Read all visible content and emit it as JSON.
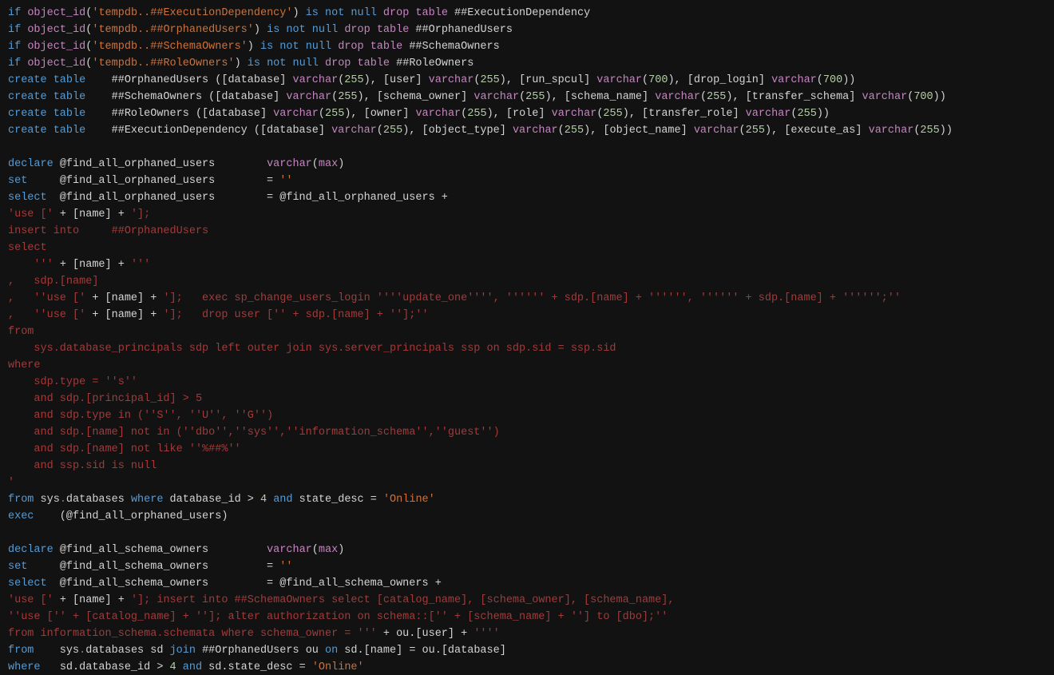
{
  "tokens": [
    [
      [
        "kw",
        "if "
      ],
      [
        "fn",
        "object_id"
      ],
      [
        "op",
        "("
      ],
      [
        "str",
        "'tempdb..##ExecutionDependency'"
      ],
      [
        "op",
        ") "
      ],
      [
        "kw",
        "is not null "
      ],
      [
        "fn",
        "drop table"
      ],
      [
        "id",
        " ##ExecutionDependency"
      ]
    ],
    [
      [
        "kw",
        "if "
      ],
      [
        "fn",
        "object_id"
      ],
      [
        "op",
        "("
      ],
      [
        "str",
        "'tempdb..##OrphanedUsers'"
      ],
      [
        "op",
        ") "
      ],
      [
        "kw",
        "is not null "
      ],
      [
        "fn",
        "drop table"
      ],
      [
        "id",
        " ##OrphanedUsers"
      ]
    ],
    [
      [
        "kw",
        "if "
      ],
      [
        "fn",
        "object_id"
      ],
      [
        "op",
        "("
      ],
      [
        "str",
        "'tempdb..##SchemaOwners'"
      ],
      [
        "op",
        ") "
      ],
      [
        "kw",
        "is not null "
      ],
      [
        "fn",
        "drop table"
      ],
      [
        "id",
        " ##SchemaOwners"
      ]
    ],
    [
      [
        "kw",
        "if "
      ],
      [
        "fn",
        "object_id"
      ],
      [
        "op",
        "("
      ],
      [
        "str",
        "'tempdb..##RoleOwners'"
      ],
      [
        "op",
        ") "
      ],
      [
        "kw",
        "is not null "
      ],
      [
        "fn",
        "drop table"
      ],
      [
        "id",
        " ##RoleOwners"
      ]
    ],
    [
      [
        "kw",
        "create table"
      ],
      [
        "id",
        "    ##OrphanedUsers ([database] "
      ],
      [
        "fn",
        "varchar"
      ],
      [
        "op",
        "("
      ],
      [
        "num",
        "255"
      ],
      [
        "op",
        "), [user] "
      ],
      [
        "fn",
        "varchar"
      ],
      [
        "op",
        "("
      ],
      [
        "num",
        "255"
      ],
      [
        "op",
        "), [run_spcul] "
      ],
      [
        "fn",
        "varchar"
      ],
      [
        "op",
        "("
      ],
      [
        "num",
        "700"
      ],
      [
        "op",
        "), [drop_login] "
      ],
      [
        "fn",
        "varchar"
      ],
      [
        "op",
        "("
      ],
      [
        "num",
        "700"
      ],
      [
        "op",
        "))"
      ]
    ],
    [
      [
        "kw",
        "create table"
      ],
      [
        "id",
        "    ##SchemaOwners ([database] "
      ],
      [
        "fn",
        "varchar"
      ],
      [
        "op",
        "("
      ],
      [
        "num",
        "255"
      ],
      [
        "op",
        "), [schema_owner] "
      ],
      [
        "fn",
        "varchar"
      ],
      [
        "op",
        "("
      ],
      [
        "num",
        "255"
      ],
      [
        "op",
        "), [schema_name] "
      ],
      [
        "fn",
        "varchar"
      ],
      [
        "op",
        "("
      ],
      [
        "num",
        "255"
      ],
      [
        "op",
        "), [transfer_schema] "
      ],
      [
        "fn",
        "varchar"
      ],
      [
        "op",
        "("
      ],
      [
        "num",
        "700"
      ],
      [
        "op",
        "))"
      ]
    ],
    [
      [
        "kw",
        "create table"
      ],
      [
        "id",
        "    ##RoleOwners ([database] "
      ],
      [
        "fn",
        "varchar"
      ],
      [
        "op",
        "("
      ],
      [
        "num",
        "255"
      ],
      [
        "op",
        "), [owner] "
      ],
      [
        "fn",
        "varchar"
      ],
      [
        "op",
        "("
      ],
      [
        "num",
        "255"
      ],
      [
        "op",
        "), [role] "
      ],
      [
        "fn",
        "varchar"
      ],
      [
        "op",
        "("
      ],
      [
        "num",
        "255"
      ],
      [
        "op",
        "), [transfer_role] "
      ],
      [
        "fn",
        "varchar"
      ],
      [
        "op",
        "("
      ],
      [
        "num",
        "255"
      ],
      [
        "op",
        "))"
      ]
    ],
    [
      [
        "kw",
        "create table"
      ],
      [
        "id",
        "    ##ExecutionDependency ([database] "
      ],
      [
        "fn",
        "varchar"
      ],
      [
        "op",
        "("
      ],
      [
        "num",
        "255"
      ],
      [
        "op",
        "), [object_type] "
      ],
      [
        "fn",
        "varchar"
      ],
      [
        "op",
        "("
      ],
      [
        "num",
        "255"
      ],
      [
        "op",
        "), [object_name] "
      ],
      [
        "fn",
        "varchar"
      ],
      [
        "op",
        "("
      ],
      [
        "num",
        "255"
      ],
      [
        "op",
        "), [execute_as] "
      ],
      [
        "fn",
        "varchar"
      ],
      [
        "op",
        "("
      ],
      [
        "num",
        "255"
      ],
      [
        "op",
        "))"
      ]
    ],
    [],
    [
      [
        "kw",
        "declare"
      ],
      [
        "id",
        " @find_all_orphaned_users        "
      ],
      [
        "fn",
        "varchar"
      ],
      [
        "op",
        "("
      ],
      [
        "fn",
        "max"
      ],
      [
        "op",
        ")"
      ]
    ],
    [
      [
        "kw",
        "set"
      ],
      [
        "id",
        "     @find_all_orphaned_users        = "
      ],
      [
        "str",
        "''"
      ]
    ],
    [
      [
        "kw",
        "select"
      ],
      [
        "id",
        "  @find_all_orphaned_users        = @find_all_orphaned_users +"
      ]
    ],
    [
      [
        "dyn",
        "'use ['"
      ],
      [
        "id",
        " + [name] + "
      ],
      [
        "dyn",
        "'];"
      ]
    ],
    [
      [
        "dyn",
        "insert into     ##OrphanedUsers"
      ]
    ],
    [
      [
        "dyn",
        "select"
      ]
    ],
    [
      [
        "dyn",
        "    '''"
      ],
      [
        "id",
        " + [name] + "
      ],
      [
        "dyn",
        "'''"
      ]
    ],
    [
      [
        "dyn",
        ",   sdp.[name]"
      ]
    ],
    [
      [
        "dyn",
        ",   ''use ['"
      ],
      [
        "id",
        " + [name] + "
      ],
      [
        "dyn",
        "'];   exec sp_change_users_login ''''update_one'''', '''''' + sdp.[name] + '''''', '''''' + sdp.[name] + '''''';''"
      ]
    ],
    [
      [
        "dyn",
        ",   ''use ['"
      ],
      [
        "id",
        " + [name] + "
      ],
      [
        "dyn",
        "'];   drop user ['' + sdp.[name] + ''];''"
      ]
    ],
    [
      [
        "dyn",
        "from"
      ]
    ],
    [
      [
        "dyn",
        "    sys.database_principals sdp left outer join sys.server_principals ssp on sdp.sid = ssp.sid"
      ]
    ],
    [
      [
        "dyn",
        "where"
      ]
    ],
    [
      [
        "dyn",
        "    sdp.type = ''s''"
      ]
    ],
    [
      [
        "dyn",
        "    and sdp.[principal_id] > 5"
      ]
    ],
    [
      [
        "dyn",
        "    and sdp.type in (''S'', ''U'', ''G'')"
      ]
    ],
    [
      [
        "dyn",
        "    and sdp.[name] not in (''dbo'',''sys'',''information_schema'',''guest'')"
      ]
    ],
    [
      [
        "dyn",
        "    and sdp.[name] not like ''%##%''"
      ]
    ],
    [
      [
        "dyn",
        "    and ssp.sid is null"
      ]
    ],
    [
      [
        "dyn",
        "'"
      ]
    ],
    [
      [
        "kw",
        "from"
      ],
      [
        "id",
        " sys"
      ],
      [
        "gray",
        "."
      ],
      [
        "id",
        "databases "
      ],
      [
        "kw",
        "where"
      ],
      [
        "id",
        " database_id > "
      ],
      [
        "num",
        "4"
      ],
      [
        "id",
        " "
      ],
      [
        "kw",
        "and"
      ],
      [
        "id",
        " state_desc = "
      ],
      [
        "str",
        "'Online'"
      ]
    ],
    [
      [
        "kw",
        "exec"
      ],
      [
        "id",
        "    (@find_all_orphaned_users)"
      ]
    ],
    [],
    [
      [
        "kw",
        "declare"
      ],
      [
        "id",
        " @find_all_schema_owners         "
      ],
      [
        "fn",
        "varchar"
      ],
      [
        "op",
        "("
      ],
      [
        "fn",
        "max"
      ],
      [
        "op",
        ")"
      ]
    ],
    [
      [
        "kw",
        "set"
      ],
      [
        "id",
        "     @find_all_schema_owners         = "
      ],
      [
        "str",
        "''"
      ]
    ],
    [
      [
        "kw",
        "select"
      ],
      [
        "id",
        "  @find_all_schema_owners         = @find_all_schema_owners +"
      ]
    ],
    [
      [
        "dyn",
        "'use ['"
      ],
      [
        "id",
        " + [name] + "
      ],
      [
        "dyn",
        "']; insert into ##SchemaOwners select [catalog_name], [schema_owner], [schema_name],"
      ]
    ],
    [
      [
        "dyn",
        "''use ['' + [catalog_name] + '']; alter authorization on schema::['' + [schema_name] + ''] to [dbo];''"
      ]
    ],
    [
      [
        "dyn",
        "from information_schema.schemata where schema_owner = '''"
      ],
      [
        "id",
        " + ou.[user] + "
      ],
      [
        "dyn",
        "''''"
      ]
    ],
    [
      [
        "kw",
        "from"
      ],
      [
        "id",
        "    sys"
      ],
      [
        "gray",
        "."
      ],
      [
        "id",
        "databases sd "
      ],
      [
        "kw",
        "join"
      ],
      [
        "id",
        " ##OrphanedUsers ou "
      ],
      [
        "kw",
        "on"
      ],
      [
        "id",
        " sd.[name] = ou.[database]"
      ]
    ],
    [
      [
        "kw",
        "where"
      ],
      [
        "id",
        "   sd.database_id > "
      ],
      [
        "num",
        "4"
      ],
      [
        "id",
        " "
      ],
      [
        "kw",
        "and"
      ],
      [
        "id",
        " sd.state_desc = "
      ],
      [
        "str",
        "'Online'"
      ]
    ]
  ]
}
